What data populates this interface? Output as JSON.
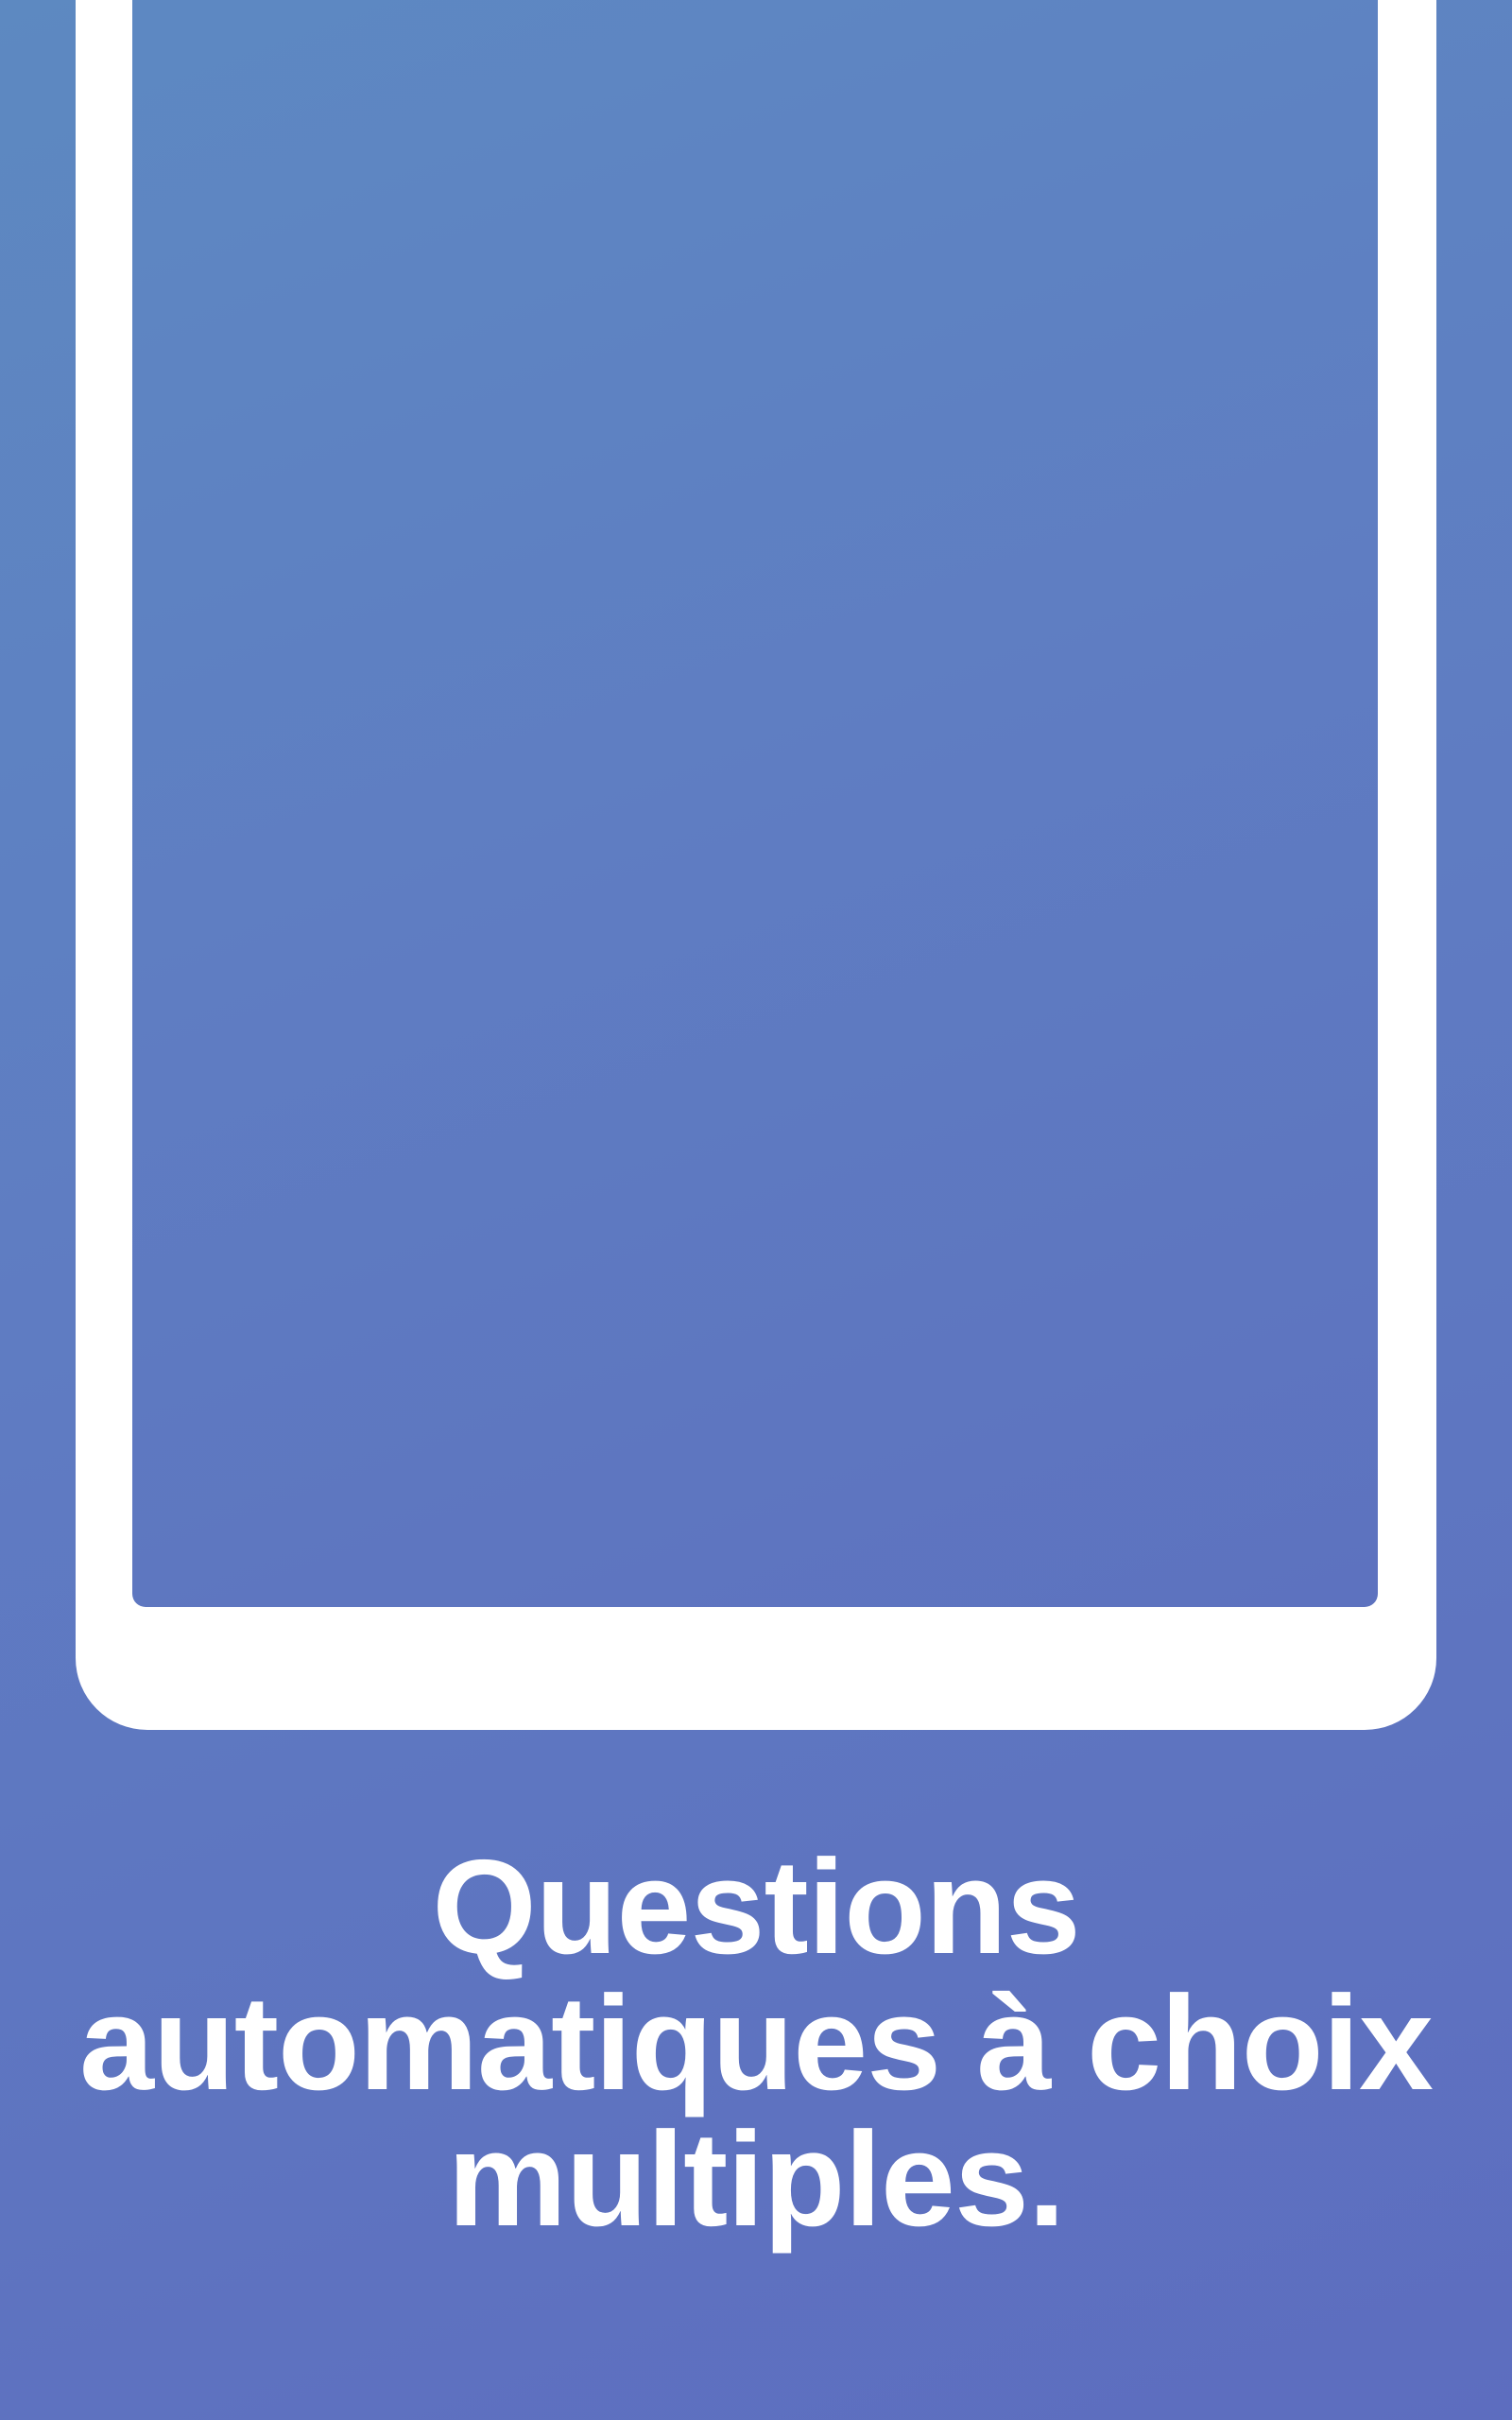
{
  "caption": {
    "line1": "Questions",
    "line2": "automatiques à choix",
    "line3": "multiples."
  },
  "colors": {
    "background_top": "#5d89c1",
    "background_bottom": "#5d6dbf",
    "frame": "#ffffff",
    "caption_text": "#ffffff"
  }
}
